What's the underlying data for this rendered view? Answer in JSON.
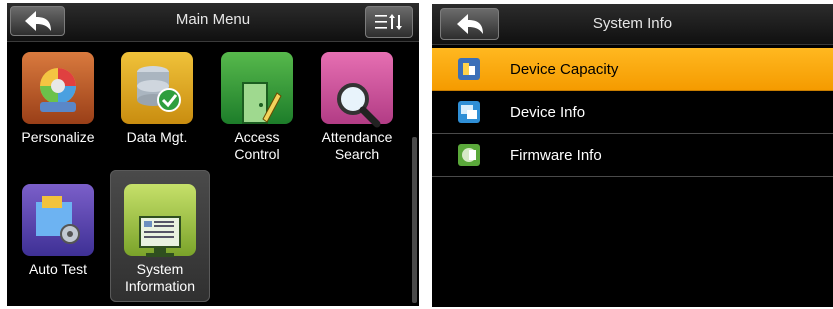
{
  "main_menu": {
    "title": "Main Menu",
    "back_icon": "back-arrow-icon",
    "sort_icon": "sort-order-icon",
    "tiles": [
      {
        "label": "Personalize",
        "icon": "personalize-icon"
      },
      {
        "label": "Data Mgt.",
        "icon": "database-check-icon"
      },
      {
        "label": "Access\nControl",
        "icon": "access-control-icon"
      },
      {
        "label": "Attendance\nSearch",
        "icon": "magnifier-icon"
      },
      {
        "label": "Auto Test",
        "icon": "auto-test-icon"
      },
      {
        "label": "System\nInformation",
        "icon": "system-information-icon"
      }
    ]
  },
  "system_info": {
    "title": "System Info",
    "back_icon": "back-arrow-icon",
    "items": [
      {
        "label": "Device Capacity",
        "icon": "device-capacity-icon"
      },
      {
        "label": "Device Info",
        "icon": "device-info-icon"
      },
      {
        "label": "Firmware Info",
        "icon": "firmware-info-icon"
      }
    ]
  },
  "colors": {
    "highlight": "#f5a700",
    "background": "#000000",
    "text": "#ffffff"
  }
}
